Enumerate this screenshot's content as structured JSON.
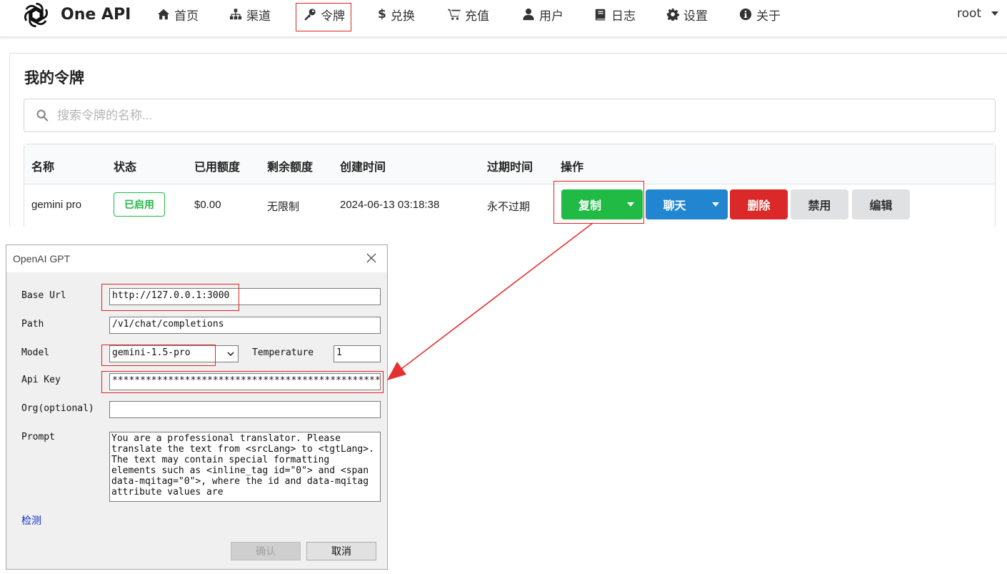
{
  "nav": {
    "brand": "One API",
    "items": [
      {
        "label": "首页",
        "icon": "home-icon"
      },
      {
        "label": "渠道",
        "icon": "sitemap-icon"
      },
      {
        "label": "令牌",
        "icon": "key-icon"
      },
      {
        "label": "兑换",
        "icon": "dollar-icon"
      },
      {
        "label": "充值",
        "icon": "cart-icon"
      },
      {
        "label": "用户",
        "icon": "user-icon"
      },
      {
        "label": "日志",
        "icon": "book-icon"
      },
      {
        "label": "设置",
        "icon": "gear-icon"
      },
      {
        "label": "关于",
        "icon": "info-icon"
      }
    ],
    "user": "root"
  },
  "page": {
    "title": "我的令牌",
    "search_placeholder": "搜索令牌的名称..."
  },
  "table": {
    "headers": [
      "名称",
      "状态",
      "已用额度",
      "剩余额度",
      "创建时间",
      "过期时间",
      "操作"
    ],
    "row": {
      "name": "gemini pro",
      "status": "已启用",
      "used": "$0.00",
      "remaining": "无限制",
      "created": "2024-06-13 03:18:38",
      "expires": "永不过期"
    },
    "actions": {
      "copy": "复制",
      "chat": "聊天",
      "delete": "删除",
      "disable": "禁用",
      "edit": "编辑"
    }
  },
  "dialog": {
    "title": "OpenAI GPT",
    "labels": {
      "base_url": "Base Url",
      "path": "Path",
      "model": "Model",
      "temperature": "Temperature",
      "api_key": "Api Key",
      "org": "Org(optional)",
      "prompt": "Prompt"
    },
    "values": {
      "base_url": "http://127.0.0.1:3000",
      "path": "/v1/chat/completions",
      "model": "gemini-1.5-pro",
      "temperature": "1",
      "api_key": "**************************************************",
      "org": "",
      "prompt": "You are a professional translator. Please translate the text from <srcLang> to <tgtLang>. The text may contain special formatting elements such as <inline_tag id=\"0\"> and <span data-mqitag=\"0\">, where the id and data-mqitag attribute values are"
    },
    "detect_link": "检测",
    "confirm": "确认",
    "cancel": "取消"
  },
  "colors": {
    "green": "#21ba45",
    "blue": "#2185d0",
    "red": "#db2828",
    "highlight": "#e02424"
  }
}
